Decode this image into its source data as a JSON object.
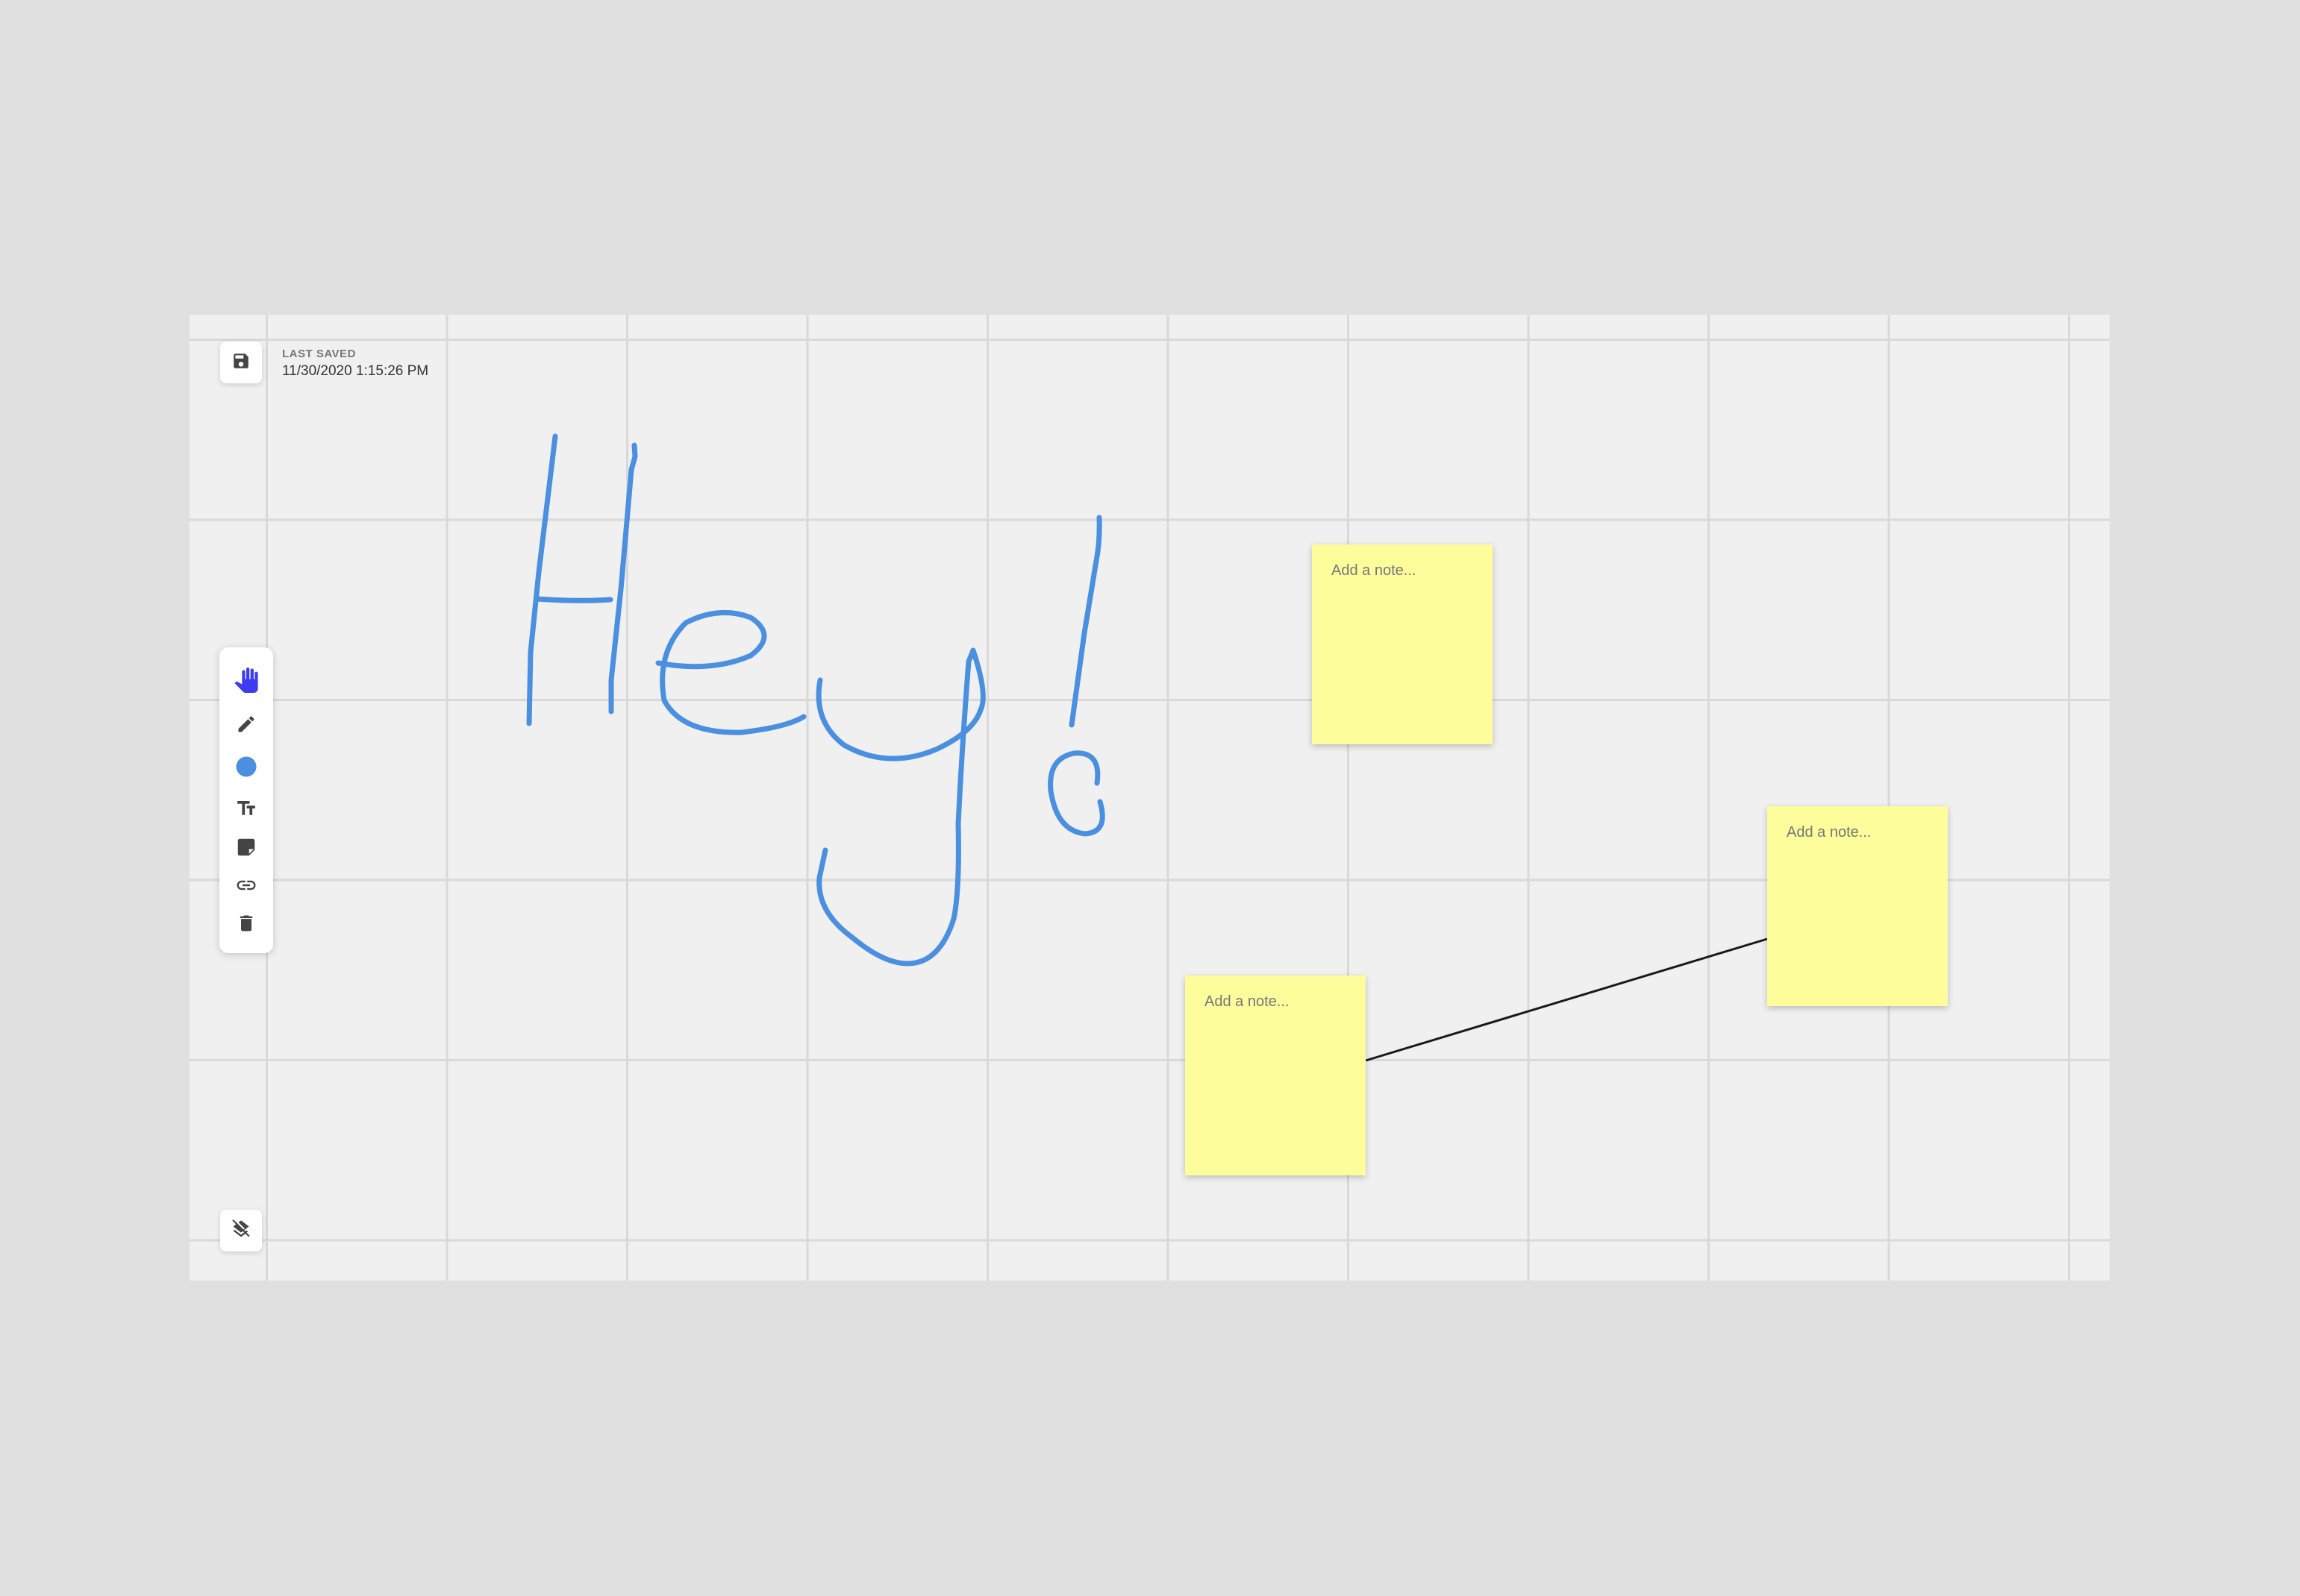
{
  "app": {
    "accent_color": "#4a8fe0",
    "active_tool_color": "#3d3df0",
    "sticky_note_color": "#fdfd9c"
  },
  "header": {
    "save_icon": "save-icon",
    "last_saved_label": "LAST SAVED",
    "last_saved_time": "11/30/2020 1:15:26 PM"
  },
  "toolbar": {
    "tools": [
      {
        "name": "hand",
        "icon": "hand-icon",
        "active": true
      },
      {
        "name": "pencil",
        "icon": "pencil-icon",
        "active": false
      },
      {
        "name": "color",
        "icon": "color-dot-icon",
        "active": false,
        "color": "#4a8fe0"
      },
      {
        "name": "text",
        "icon": "text-icon",
        "active": false
      },
      {
        "name": "sticky-note",
        "icon": "sticky-note-icon",
        "active": false
      },
      {
        "name": "link",
        "icon": "link-icon",
        "active": false
      },
      {
        "name": "delete",
        "icon": "trash-icon",
        "active": false
      }
    ]
  },
  "canvas": {
    "drawing": "Hey!",
    "stroke_color": "#4a8fe0",
    "notes": [
      {
        "placeholder": "Add a note..."
      },
      {
        "placeholder": "Add a note..."
      },
      {
        "placeholder": "Add a note..."
      }
    ],
    "connector_color": "#1a1a1a"
  },
  "footer": {
    "layers_icon": "layers-off-icon"
  }
}
